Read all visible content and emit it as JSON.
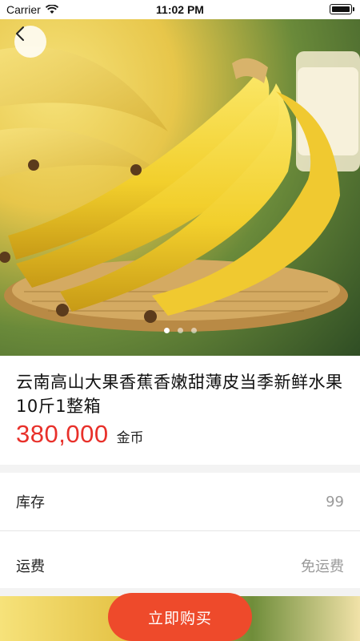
{
  "status_bar": {
    "carrier": "Carrier",
    "time": "11:02 PM"
  },
  "gallery": {
    "page_count": 3,
    "active_index": 0
  },
  "product": {
    "title": "云南高山大果香蕉香嫩甜薄皮当季新鲜水果10斤1整箱",
    "price": "380,000",
    "currency": "金币"
  },
  "details": {
    "stock_label": "库存",
    "stock_value": "99",
    "shipping_label": "运费",
    "shipping_value": "免运费"
  },
  "actions": {
    "buy_label": "立即购买"
  },
  "colors": {
    "price": "#e8302a",
    "buy_button": "#ee4a2b"
  }
}
